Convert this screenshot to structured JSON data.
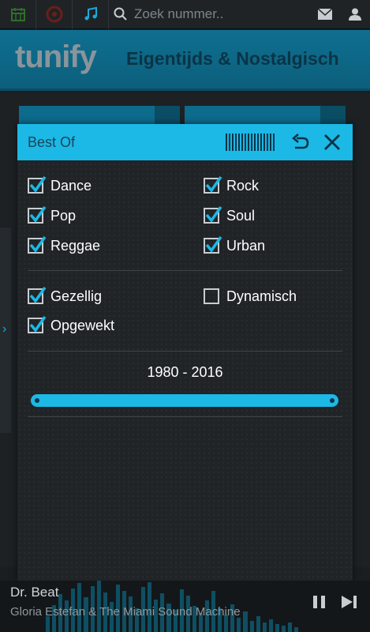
{
  "search": {
    "placeholder": "Zoek nummer.."
  },
  "header": {
    "logo": "tunify",
    "title": "Eigentijds & Nostalgisch"
  },
  "modal": {
    "title": "Best Of",
    "genres": [
      {
        "label": "Dance",
        "checked": true
      },
      {
        "label": "Rock",
        "checked": true
      },
      {
        "label": "Pop",
        "checked": true
      },
      {
        "label": "Soul",
        "checked": true
      },
      {
        "label": "Reggae",
        "checked": true
      },
      {
        "label": "Urban",
        "checked": true
      }
    ],
    "moods": [
      {
        "label": "Gezellig",
        "checked": true
      },
      {
        "label": "Dynamisch",
        "checked": false
      },
      {
        "label": "Opgewekt",
        "checked": true
      }
    ],
    "year_range": {
      "label": "1980 - 2016",
      "min": 1980,
      "max": 2016
    }
  },
  "player": {
    "track_title": "Dr. Beat",
    "track_artist": "Gloria Estefan & The Miami Sound Machine"
  },
  "colors": {
    "accent": "#1cb8e6",
    "header_bg": "#0f6f90",
    "dark_text": "#0b3446"
  }
}
